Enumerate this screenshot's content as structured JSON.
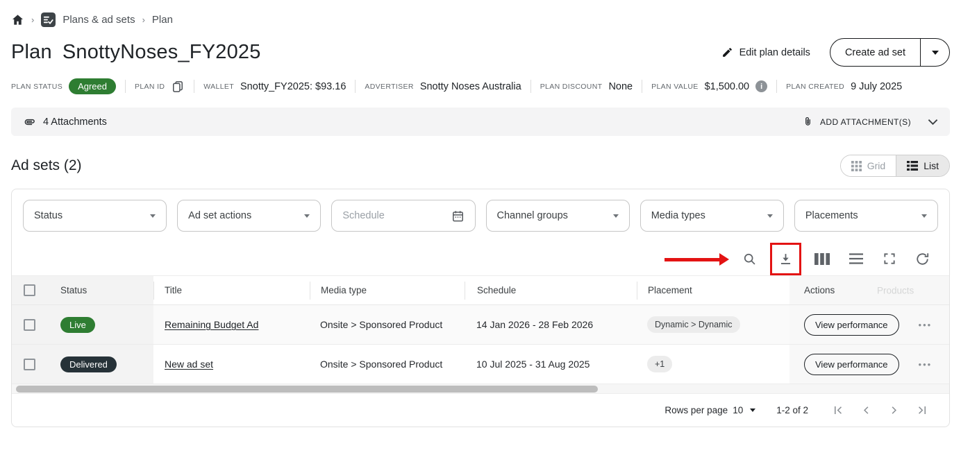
{
  "breadcrumb": {
    "section": "Plans & ad sets",
    "current": "Plan"
  },
  "header": {
    "title_prefix": "Plan",
    "title_name": "SnottyNoses_FY2025",
    "edit_label": "Edit plan details",
    "create_label": "Create ad set"
  },
  "meta": {
    "status_label": "PLAN STATUS",
    "status_value": "Agreed",
    "plan_id_label": "PLAN ID",
    "wallet_label": "WALLET",
    "wallet_value": "Snotty_FY2025: $93.16",
    "advertiser_label": "ADVERTISER",
    "advertiser_value": "Snotty Noses Australia",
    "discount_label": "PLAN DISCOUNT",
    "discount_value": "None",
    "value_label": "PLAN VALUE",
    "value_value": "$1,500.00",
    "info_glyph": "i",
    "created_label": "PLAN CREATED",
    "created_value": "9 July 2025"
  },
  "attachments": {
    "count_label": "4 Attachments",
    "add_label": "ADD ATTACHMENT(S)"
  },
  "adsets": {
    "heading": "Ad sets (2)",
    "grid_label": "Grid",
    "list_label": "List"
  },
  "filters": [
    {
      "label": "Status",
      "type": "select"
    },
    {
      "label": "Ad set actions",
      "type": "select"
    },
    {
      "label": "Schedule",
      "type": "date",
      "placeholder": "Schedule"
    },
    {
      "label": "Channel groups",
      "type": "select"
    },
    {
      "label": "Media types",
      "type": "select"
    },
    {
      "label": "Placements",
      "type": "select"
    }
  ],
  "toolbar": {
    "icons": [
      "search",
      "download",
      "view-columns",
      "density",
      "fullscreen",
      "refresh"
    ],
    "annotation": {
      "shape": "arrow-and-box",
      "target": "download-icon",
      "color": "#e31313"
    }
  },
  "table": {
    "columns": [
      "Status",
      "Title",
      "Media type",
      "Schedule",
      "Placement",
      "Actions"
    ],
    "hidden_column": "Products",
    "rows": [
      {
        "status": "Live",
        "status_color": "#2e7d32",
        "title": "Remaining Budget Ad",
        "media_type": "Onsite > Sponsored Product",
        "schedule": "14 Jan 2026 - 28 Feb 2026",
        "placement": "Dynamic > Dynamic",
        "action": "View performance",
        "more": "•••"
      },
      {
        "status": "Delivered",
        "status_color": "#263238",
        "title": "New ad set",
        "media_type": "Onsite > Sponsored Product",
        "schedule": "10 Jul 2025 - 31 Aug 2025",
        "placement": "+1",
        "action": "View performance",
        "more": "•••"
      }
    ]
  },
  "pagination": {
    "rows_per_page_label": "Rows per page",
    "rows_per_page_value": "10",
    "range": "1-2 of 2"
  },
  "colors": {
    "badge_green": "#2e7d32",
    "badge_dark": "#263238",
    "annotation_red": "#e31313",
    "chip_gray": "#ececec"
  }
}
